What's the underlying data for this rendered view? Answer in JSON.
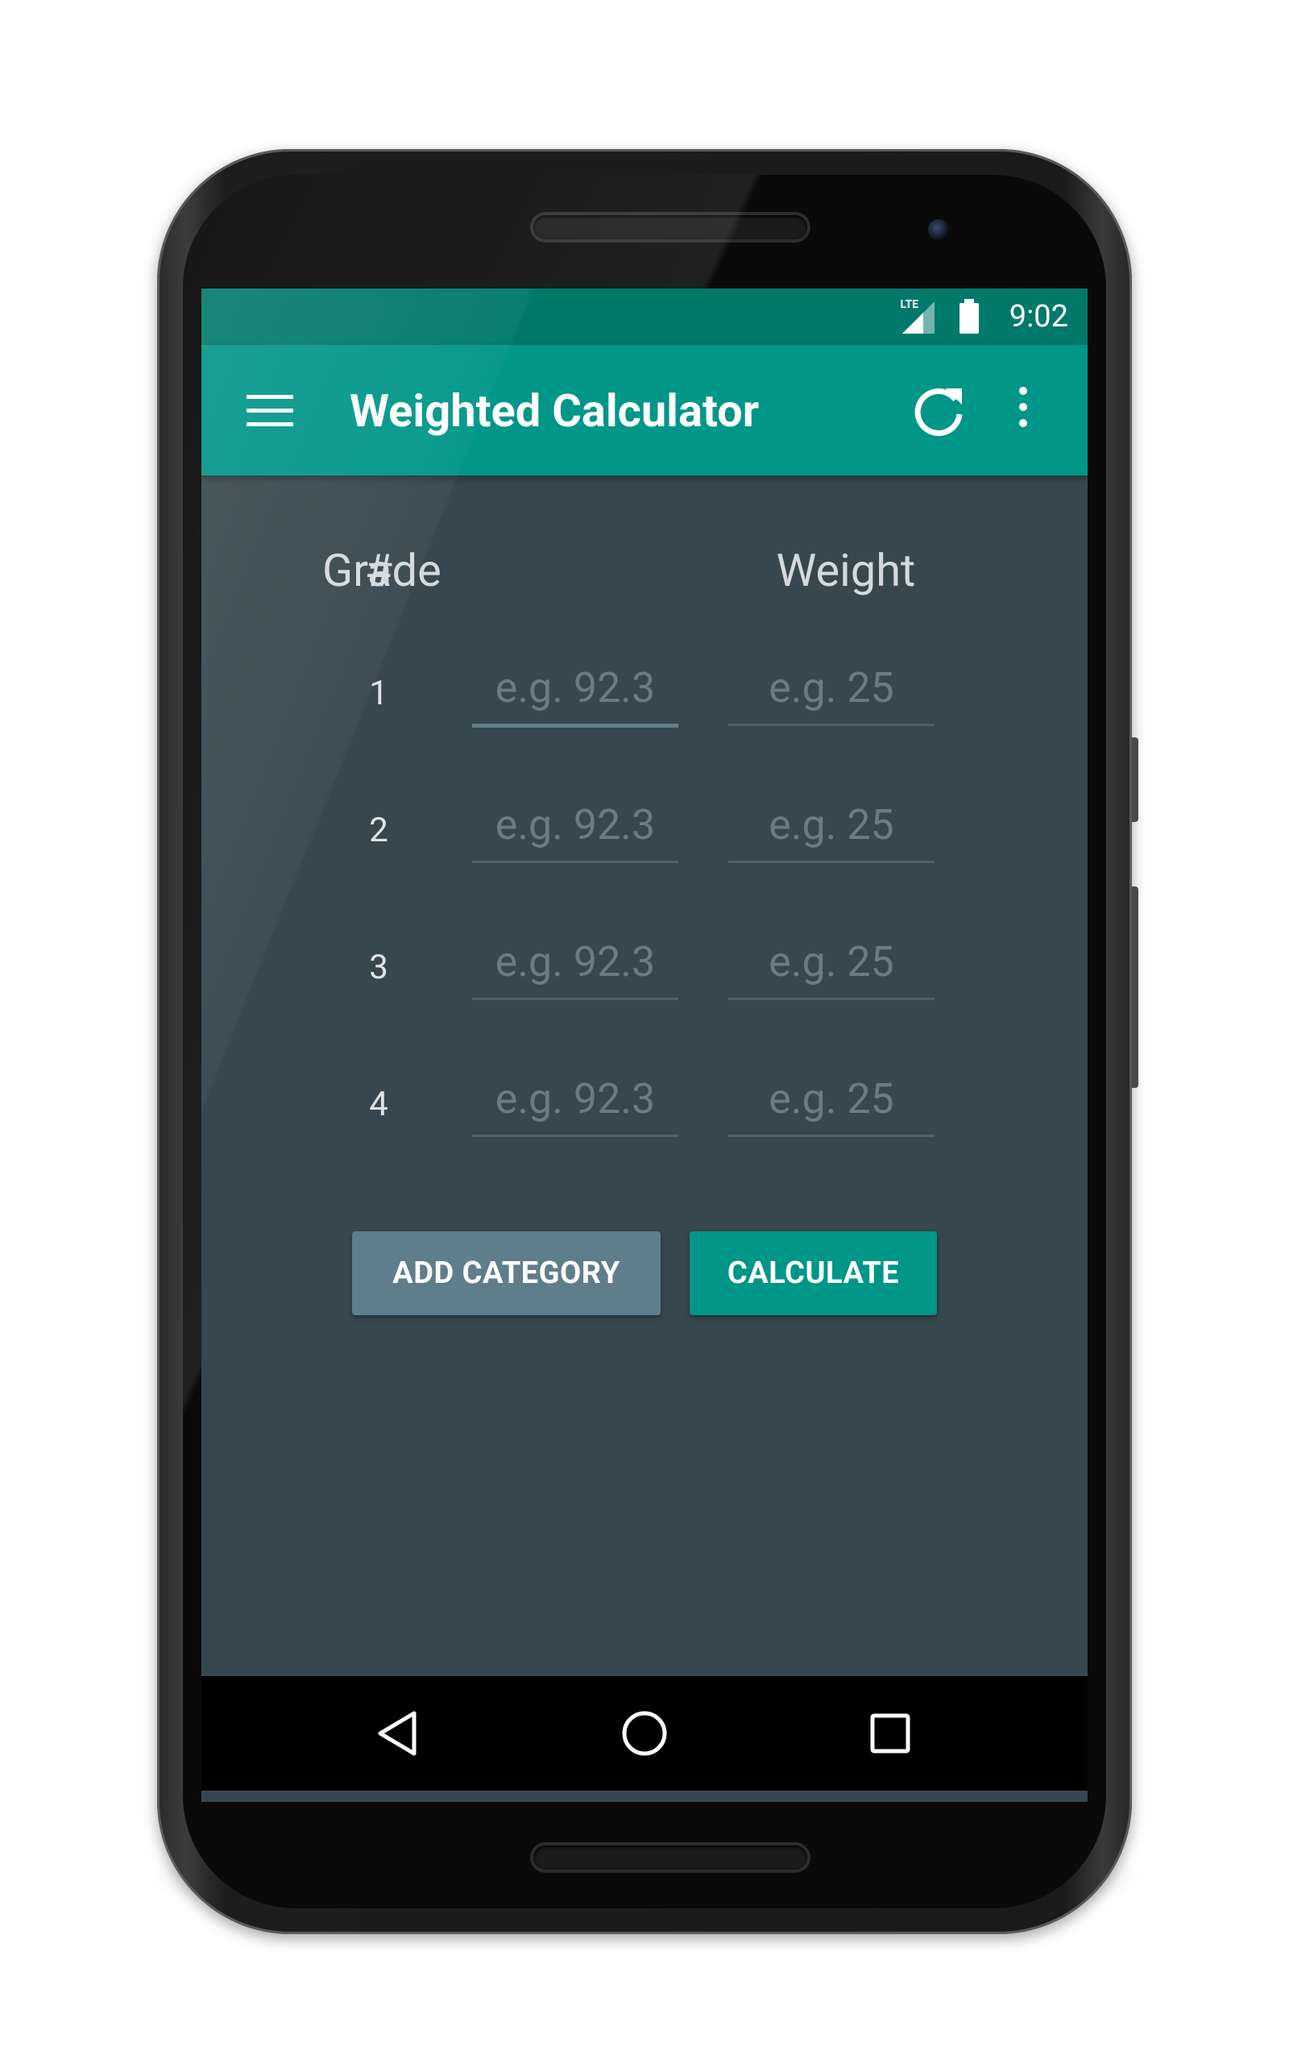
{
  "status_bar": {
    "network": "LTE",
    "time": "9:02"
  },
  "app_bar": {
    "title": "Weighted Calculator",
    "menu_icon": "hamburger-menu-icon",
    "refresh_icon": "refresh-icon",
    "overflow_icon": "more-vert-icon"
  },
  "table": {
    "headers": [
      "#",
      "Grade",
      "Weight"
    ],
    "rows": [
      {
        "num": "1",
        "grade_value": "",
        "grade_placeholder": "e.g. 92.3",
        "weight_value": "",
        "weight_placeholder": "e.g. 25"
      },
      {
        "num": "2",
        "grade_value": "",
        "grade_placeholder": "e.g. 92.3",
        "weight_value": "",
        "weight_placeholder": "e.g. 25"
      },
      {
        "num": "3",
        "grade_value": "",
        "grade_placeholder": "e.g. 92.3",
        "weight_value": "",
        "weight_placeholder": "e.g. 25"
      },
      {
        "num": "4",
        "grade_value": "",
        "grade_placeholder": "e.g. 92.3",
        "weight_value": "",
        "weight_placeholder": "e.g. 25"
      }
    ]
  },
  "actions": {
    "add_category_label": "ADD CATEGORY",
    "calculate_label": "CALCULATE"
  },
  "nav_bar": {
    "back_icon": "back-triangle-icon",
    "home_icon": "home-circle-icon",
    "recents_icon": "recents-square-icon"
  },
  "colors": {
    "primary": "#009688",
    "primary_dark": "#00796b",
    "background": "#37474f",
    "secondary_button": "#607d8b",
    "hint_text": "#6b7b83"
  }
}
